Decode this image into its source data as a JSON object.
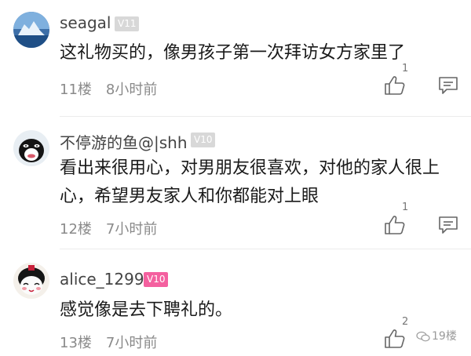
{
  "comments": [
    {
      "username": "seagal",
      "level": "V11",
      "text": "这礼物买的，像男孩子第一次拜访女方家里了",
      "floor": "11楼",
      "time": "8小时前",
      "likes": "1",
      "avatar_icon": "iceberg-avatar"
    },
    {
      "username": "不停游的鱼@|shh",
      "level": "V10",
      "text": "看出来很用心，对男朋友很喜欢，对他的家人很上心，希望男友家人和你都能对上眼",
      "floor": "12楼",
      "time": "7小时前",
      "likes": "1",
      "avatar_icon": "orca-avatar"
    },
    {
      "username": "alice_1299",
      "level": "V10",
      "text": "感觉像是去下聘礼的。",
      "floor": "13楼",
      "time": "7小时前",
      "likes": "2",
      "avatar_icon": "cartoon-girl-avatar"
    }
  ],
  "watermark": "19楼",
  "colors": {
    "level_grey": "#d8d8d8",
    "level_pink": "#f4609f",
    "meta_text": "#8a8a8a"
  }
}
